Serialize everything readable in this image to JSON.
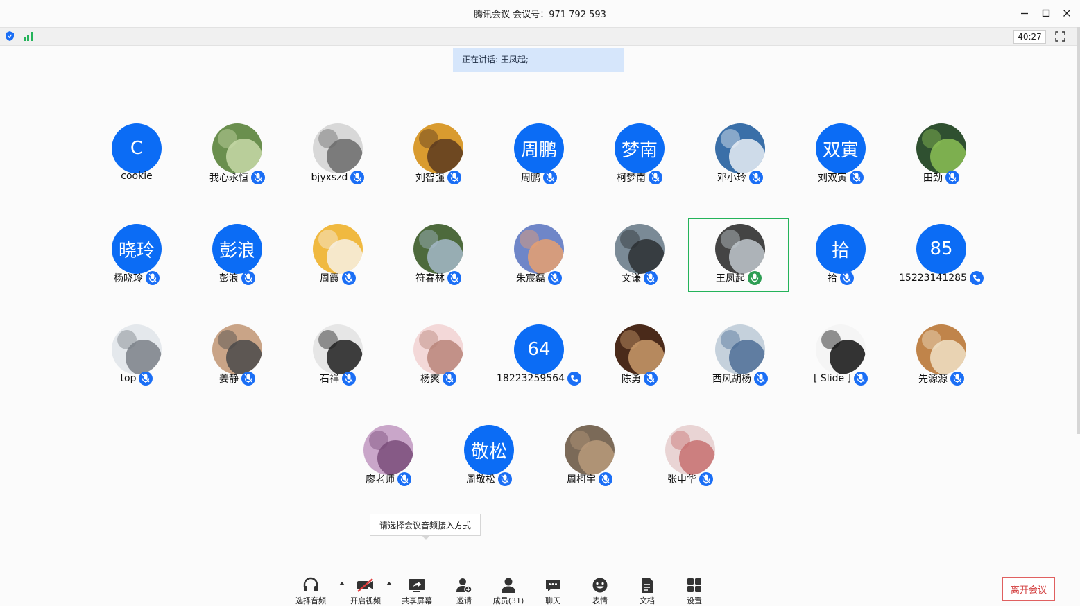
{
  "window": {
    "title": "腾讯会议 会议号：971 792 593",
    "timer": "40:27"
  },
  "speaking": "正在讲话: 王凤起;",
  "participants": [
    {
      "name": "cookie",
      "avatar_text": "C",
      "photo": false,
      "mic": "none"
    },
    {
      "name": "我心永恒",
      "avatar_text": "",
      "photo": true,
      "mic": "muted"
    },
    {
      "name": "bjyxszd",
      "avatar_text": "",
      "photo": true,
      "mic": "muted"
    },
    {
      "name": "刘智强",
      "avatar_text": "",
      "photo": true,
      "mic": "muted"
    },
    {
      "name": "周鹏",
      "avatar_text": "周鹏",
      "photo": false,
      "mic": "muted"
    },
    {
      "name": "柯梦南",
      "avatar_text": "梦南",
      "photo": false,
      "mic": "muted"
    },
    {
      "name": "邓小玲",
      "avatar_text": "",
      "photo": true,
      "mic": "muted"
    },
    {
      "name": "刘双寅",
      "avatar_text": "双寅",
      "photo": false,
      "mic": "muted"
    },
    {
      "name": "田劲",
      "avatar_text": "",
      "photo": true,
      "mic": "muted"
    },
    {
      "name": "杨晓玲",
      "avatar_text": "晓玲",
      "photo": false,
      "mic": "muted"
    },
    {
      "name": "彭浪",
      "avatar_text": "彭浪",
      "photo": false,
      "mic": "muted"
    },
    {
      "name": "周霞",
      "avatar_text": "",
      "photo": true,
      "mic": "muted"
    },
    {
      "name": "符春林",
      "avatar_text": "",
      "photo": true,
      "mic": "muted"
    },
    {
      "name": "朱宸磊",
      "avatar_text": "",
      "photo": true,
      "mic": "muted"
    },
    {
      "name": "文谦",
      "avatar_text": "",
      "photo": true,
      "mic": "muted"
    },
    {
      "name": "王凤起",
      "avatar_text": "",
      "photo": true,
      "mic": "speaking"
    },
    {
      "name": "拾",
      "avatar_text": "拾",
      "photo": false,
      "mic": "muted"
    },
    {
      "name": "15223141285",
      "avatar_text": "85",
      "photo": false,
      "mic": "phone"
    },
    {
      "name": "top",
      "avatar_text": "",
      "photo": true,
      "mic": "muted"
    },
    {
      "name": "姜静",
      "avatar_text": "",
      "photo": true,
      "mic": "muted"
    },
    {
      "name": "石祥",
      "avatar_text": "",
      "photo": true,
      "mic": "muted"
    },
    {
      "name": "杨爽",
      "avatar_text": "",
      "photo": true,
      "mic": "muted"
    },
    {
      "name": "18223259564",
      "avatar_text": "64",
      "photo": false,
      "mic": "phone"
    },
    {
      "name": "陈勇",
      "avatar_text": "",
      "photo": true,
      "mic": "muted"
    },
    {
      "name": "西风胡杨",
      "avatar_text": "",
      "photo": true,
      "mic": "muted"
    },
    {
      "name": "[ Slide ]",
      "avatar_text": "",
      "photo": true,
      "mic": "muted"
    },
    {
      "name": "先源源",
      "avatar_text": "",
      "photo": true,
      "mic": "muted"
    },
    {
      "name": "廖老师",
      "avatar_text": "",
      "photo": true,
      "mic": "muted"
    },
    {
      "name": "周敬松",
      "avatar_text": "敬松",
      "photo": false,
      "mic": "muted"
    },
    {
      "name": "周柯宇",
      "avatar_text": "",
      "photo": true,
      "mic": "muted"
    },
    {
      "name": "张申华",
      "avatar_text": "",
      "photo": true,
      "mic": "muted"
    }
  ],
  "tooltip": "请选择会议音频接入方式",
  "toolbar": {
    "audio": "选择音频",
    "video": "开启视频",
    "share": "共享屏幕",
    "invite": "邀请",
    "members": "成员(31)",
    "chat": "聊天",
    "emoji": "表情",
    "docs": "文档",
    "settings": "设置",
    "leave": "离开会议"
  },
  "colors": {
    "accent": "#0b6cf5",
    "active_border": "#24b35a",
    "speaking_bg": "#d6e6fb",
    "leave": "#d23b3b"
  }
}
